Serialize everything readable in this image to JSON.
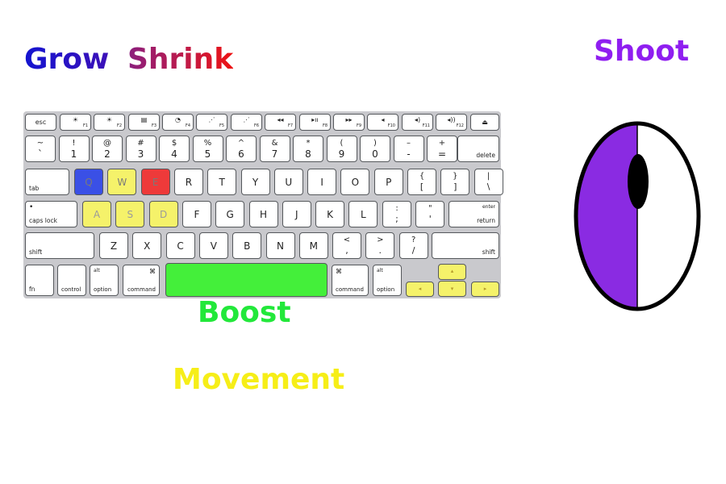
{
  "labels": {
    "grow": "Grow",
    "shrink": "Shrink",
    "shoot": "Shoot",
    "boost": "Boost",
    "movement": "Movement"
  },
  "colors": {
    "grow": "#2020d8",
    "shrink": "#d0203c",
    "shoot": "#8f1ef0",
    "boost": "#22e83a",
    "movement": "#f6ee18",
    "key_q": "#3a50e6",
    "key_move": "#f5f26a",
    "key_e": "#ee3a3a",
    "key_space": "#44ef3a",
    "mouse_left": "#8a2be2"
  },
  "keyboard": {
    "fn_row": [
      {
        "main": "esc"
      },
      {
        "main": "☀",
        "sub": "F1"
      },
      {
        "main": "☀",
        "sub": "F2"
      },
      {
        "main": "▤",
        "sub": "F3"
      },
      {
        "main": "◔",
        "sub": "F4"
      },
      {
        "main": "⋰",
        "sub": "F5"
      },
      {
        "main": "⋰",
        "sub": "F6"
      },
      {
        "main": "◂◂",
        "sub": "F7"
      },
      {
        "main": "▸ıı",
        "sub": "F8"
      },
      {
        "main": "▸▸",
        "sub": "F9"
      },
      {
        "main": "◂",
        "sub": "F10"
      },
      {
        "main": "◂)",
        "sub": "F11"
      },
      {
        "main": "◂))",
        "sub": "F12"
      },
      {
        "main": "⏏"
      }
    ],
    "number_row": [
      {
        "top": "~",
        "bot": "`"
      },
      {
        "top": "!",
        "bot": "1"
      },
      {
        "top": "@",
        "bot": "2"
      },
      {
        "top": "#",
        "bot": "3"
      },
      {
        "top": "$",
        "bot": "4"
      },
      {
        "top": "%",
        "bot": "5"
      },
      {
        "top": "^",
        "bot": "6"
      },
      {
        "top": "&",
        "bot": "7"
      },
      {
        "top": "*",
        "bot": "8"
      },
      {
        "top": "(",
        "bot": "9"
      },
      {
        "top": ")",
        "bot": "0"
      },
      {
        "top": "–",
        "bot": "-"
      },
      {
        "top": "+",
        "bot": "="
      }
    ],
    "delete": "delete",
    "tab": "tab",
    "q_row": [
      "Q",
      "W",
      "E",
      "R",
      "T",
      "Y",
      "U",
      "I",
      "O",
      "P"
    ],
    "q_row_symbols": [
      {
        "top": "{",
        "bot": "["
      },
      {
        "top": "}",
        "bot": "]"
      },
      {
        "top": "|",
        "bot": "\\"
      }
    ],
    "caps_lock": "caps lock",
    "caps_dot": "•",
    "a_row": [
      "A",
      "S",
      "D",
      "F",
      "G",
      "H",
      "J",
      "K",
      "L"
    ],
    "a_row_symbols": [
      {
        "top": ":",
        "bot": ";"
      },
      {
        "top": "\"",
        "bot": "'"
      }
    ],
    "enter_top": "enter",
    "enter": "return",
    "shift": "shift",
    "z_row": [
      "Z",
      "X",
      "C",
      "V",
      "B",
      "N",
      "M"
    ],
    "z_row_symbols": [
      {
        "top": "<",
        "bot": ","
      },
      {
        "top": ">",
        "bot": "."
      },
      {
        "top": "?",
        "bot": "/"
      }
    ],
    "fn": "fn",
    "control": "control",
    "alt": "alt",
    "option": "option",
    "cmd_symbol": "⌘",
    "command": "command",
    "arrow_left": "◂",
    "arrow_up": "▴",
    "arrow_down": "▾",
    "arrow_right": "▸"
  }
}
